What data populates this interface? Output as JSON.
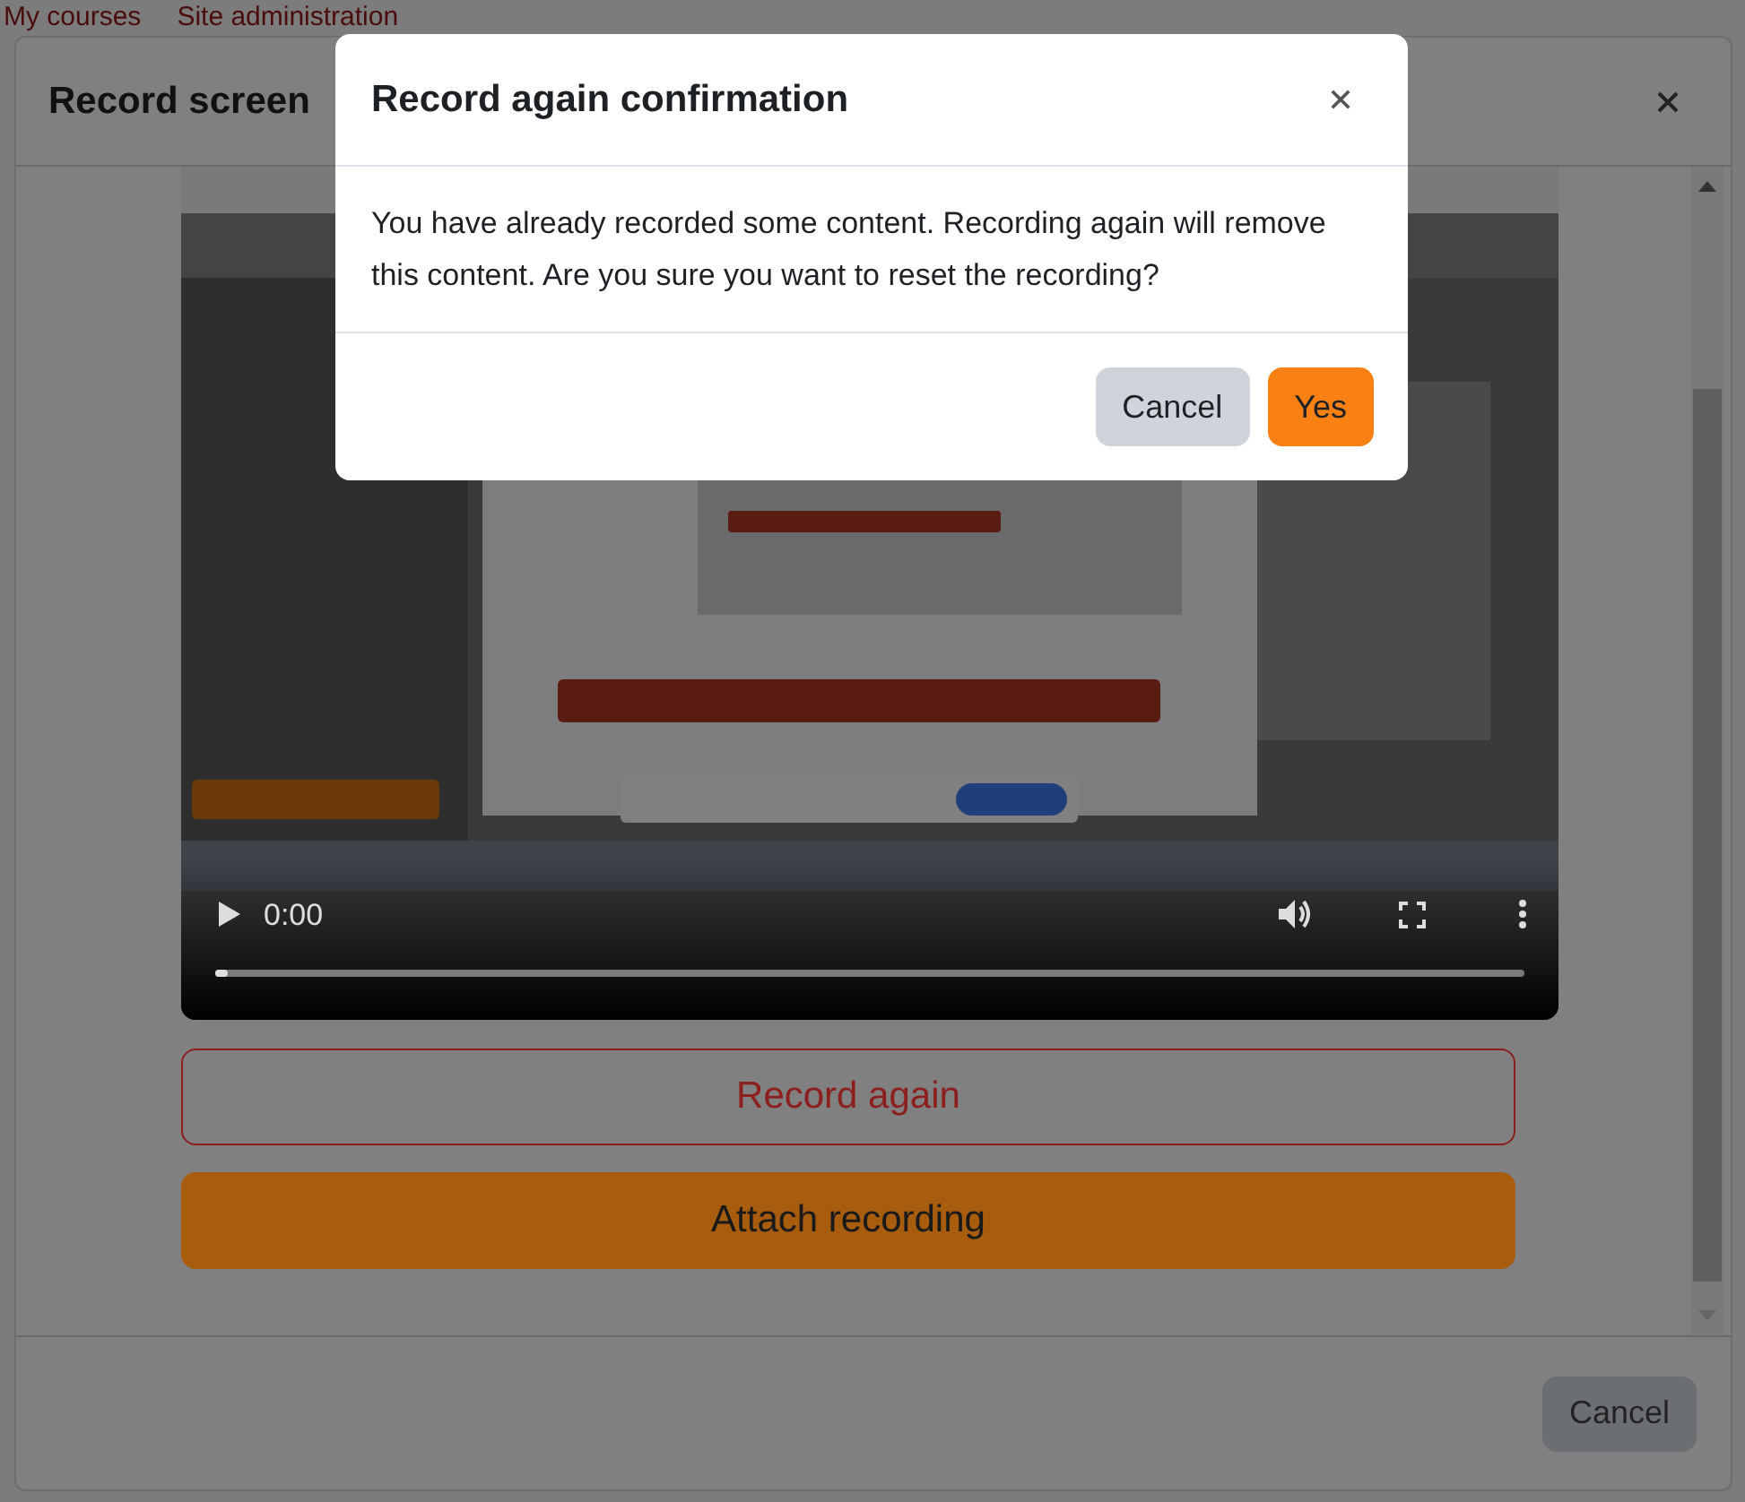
{
  "background_nav": [
    "My courses",
    "Site administration"
  ],
  "record_modal": {
    "title": "Record screen",
    "video": {
      "kind": "picture",
      "time": "0:00",
      "level": 0.01
    },
    "buttons": [
      {
        "label": "Record again",
        "kind": "outline"
      },
      {
        "label": "Attach recording",
        "kind": "primary"
      }
    ],
    "footer_button": "Cancel"
  },
  "confirm_dialog": {
    "title": "Record again confirmation",
    "message": "You have already recorded some content. Recording again will remove this content. Are you sure you want to reset the recording?",
    "buttons": [
      {
        "label": "Cancel",
        "kind": "secondary"
      },
      {
        "label": "Yes",
        "kind": "primary"
      }
    ]
  }
}
